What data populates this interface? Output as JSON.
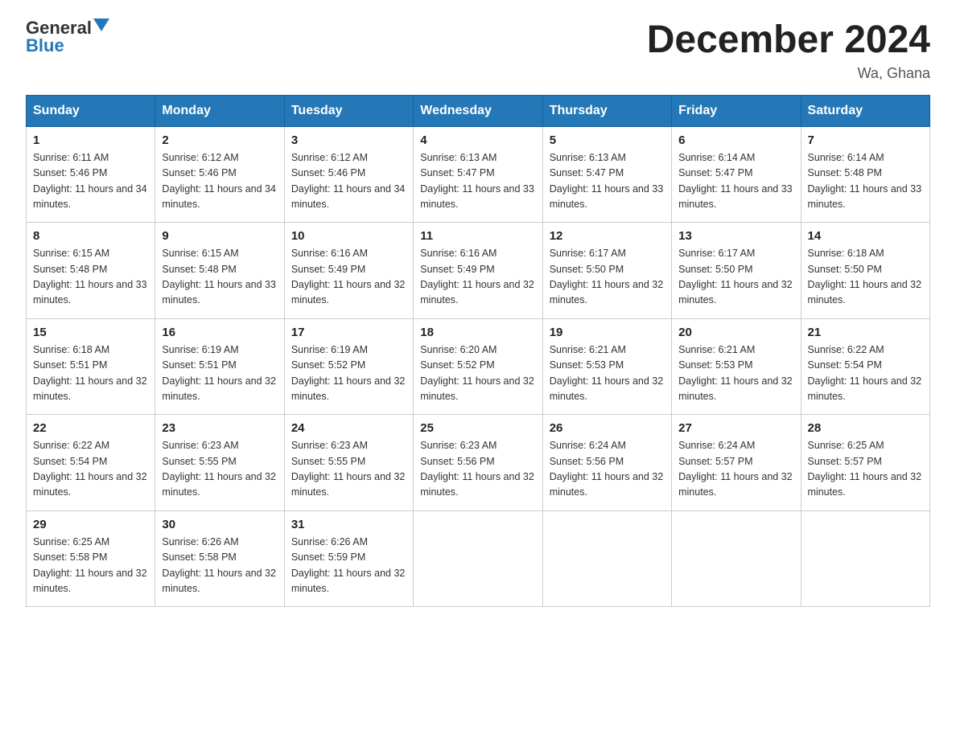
{
  "header": {
    "logo_general": "General",
    "logo_blue": "Blue",
    "title": "December 2024",
    "location": "Wa, Ghana"
  },
  "days_of_week": [
    "Sunday",
    "Monday",
    "Tuesday",
    "Wednesday",
    "Thursday",
    "Friday",
    "Saturday"
  ],
  "weeks": [
    [
      {
        "num": "1",
        "sunrise": "6:11 AM",
        "sunset": "5:46 PM",
        "daylight": "11 hours and 34 minutes."
      },
      {
        "num": "2",
        "sunrise": "6:12 AM",
        "sunset": "5:46 PM",
        "daylight": "11 hours and 34 minutes."
      },
      {
        "num": "3",
        "sunrise": "6:12 AM",
        "sunset": "5:46 PM",
        "daylight": "11 hours and 34 minutes."
      },
      {
        "num": "4",
        "sunrise": "6:13 AM",
        "sunset": "5:47 PM",
        "daylight": "11 hours and 33 minutes."
      },
      {
        "num": "5",
        "sunrise": "6:13 AM",
        "sunset": "5:47 PM",
        "daylight": "11 hours and 33 minutes."
      },
      {
        "num": "6",
        "sunrise": "6:14 AM",
        "sunset": "5:47 PM",
        "daylight": "11 hours and 33 minutes."
      },
      {
        "num": "7",
        "sunrise": "6:14 AM",
        "sunset": "5:48 PM",
        "daylight": "11 hours and 33 minutes."
      }
    ],
    [
      {
        "num": "8",
        "sunrise": "6:15 AM",
        "sunset": "5:48 PM",
        "daylight": "11 hours and 33 minutes."
      },
      {
        "num": "9",
        "sunrise": "6:15 AM",
        "sunset": "5:48 PM",
        "daylight": "11 hours and 33 minutes."
      },
      {
        "num": "10",
        "sunrise": "6:16 AM",
        "sunset": "5:49 PM",
        "daylight": "11 hours and 32 minutes."
      },
      {
        "num": "11",
        "sunrise": "6:16 AM",
        "sunset": "5:49 PM",
        "daylight": "11 hours and 32 minutes."
      },
      {
        "num": "12",
        "sunrise": "6:17 AM",
        "sunset": "5:50 PM",
        "daylight": "11 hours and 32 minutes."
      },
      {
        "num": "13",
        "sunrise": "6:17 AM",
        "sunset": "5:50 PM",
        "daylight": "11 hours and 32 minutes."
      },
      {
        "num": "14",
        "sunrise": "6:18 AM",
        "sunset": "5:50 PM",
        "daylight": "11 hours and 32 minutes."
      }
    ],
    [
      {
        "num": "15",
        "sunrise": "6:18 AM",
        "sunset": "5:51 PM",
        "daylight": "11 hours and 32 minutes."
      },
      {
        "num": "16",
        "sunrise": "6:19 AM",
        "sunset": "5:51 PM",
        "daylight": "11 hours and 32 minutes."
      },
      {
        "num": "17",
        "sunrise": "6:19 AM",
        "sunset": "5:52 PM",
        "daylight": "11 hours and 32 minutes."
      },
      {
        "num": "18",
        "sunrise": "6:20 AM",
        "sunset": "5:52 PM",
        "daylight": "11 hours and 32 minutes."
      },
      {
        "num": "19",
        "sunrise": "6:21 AM",
        "sunset": "5:53 PM",
        "daylight": "11 hours and 32 minutes."
      },
      {
        "num": "20",
        "sunrise": "6:21 AM",
        "sunset": "5:53 PM",
        "daylight": "11 hours and 32 minutes."
      },
      {
        "num": "21",
        "sunrise": "6:22 AM",
        "sunset": "5:54 PM",
        "daylight": "11 hours and 32 minutes."
      }
    ],
    [
      {
        "num": "22",
        "sunrise": "6:22 AM",
        "sunset": "5:54 PM",
        "daylight": "11 hours and 32 minutes."
      },
      {
        "num": "23",
        "sunrise": "6:23 AM",
        "sunset": "5:55 PM",
        "daylight": "11 hours and 32 minutes."
      },
      {
        "num": "24",
        "sunrise": "6:23 AM",
        "sunset": "5:55 PM",
        "daylight": "11 hours and 32 minutes."
      },
      {
        "num": "25",
        "sunrise": "6:23 AM",
        "sunset": "5:56 PM",
        "daylight": "11 hours and 32 minutes."
      },
      {
        "num": "26",
        "sunrise": "6:24 AM",
        "sunset": "5:56 PM",
        "daylight": "11 hours and 32 minutes."
      },
      {
        "num": "27",
        "sunrise": "6:24 AM",
        "sunset": "5:57 PM",
        "daylight": "11 hours and 32 minutes."
      },
      {
        "num": "28",
        "sunrise": "6:25 AM",
        "sunset": "5:57 PM",
        "daylight": "11 hours and 32 minutes."
      }
    ],
    [
      {
        "num": "29",
        "sunrise": "6:25 AM",
        "sunset": "5:58 PM",
        "daylight": "11 hours and 32 minutes."
      },
      {
        "num": "30",
        "sunrise": "6:26 AM",
        "sunset": "5:58 PM",
        "daylight": "11 hours and 32 minutes."
      },
      {
        "num": "31",
        "sunrise": "6:26 AM",
        "sunset": "5:59 PM",
        "daylight": "11 hours and 32 minutes."
      },
      null,
      null,
      null,
      null
    ]
  ]
}
